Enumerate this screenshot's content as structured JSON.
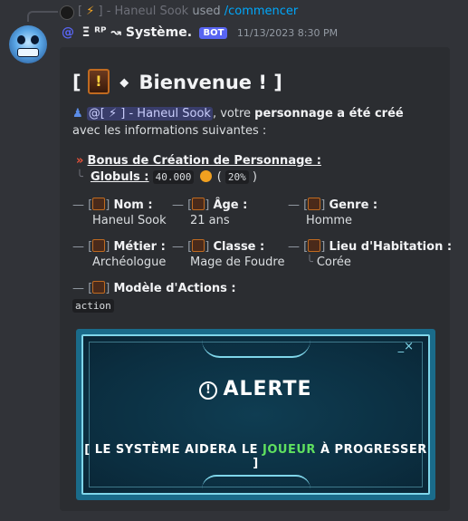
{
  "reply": {
    "prefix": "[",
    "name": "] - Haneul Sook",
    "used": "used",
    "command": "/commencer"
  },
  "header": {
    "username": "Ξ ᴿᴾ ↝ Système.",
    "bot_badge": "BOT",
    "timestamp": "11/13/2023 8:30 PM"
  },
  "embed": {
    "title_open": "[",
    "title_text": "Bienvenue ! ]",
    "mention": "@[ ⚡ ] - Haneul Sook",
    "desc_1": ", votre ",
    "desc_bold": "personnage a été créé",
    "desc_2": " avec les informations suivantes :",
    "bonus_title": "Bonus de Création de Personnage :",
    "globuls_label": "Globuls :",
    "globuls_amount": "40.000",
    "globuls_pct": "20%",
    "fields": [
      {
        "label": "Nom :",
        "value": "Haneul Sook"
      },
      {
        "label": "Âge :",
        "value": "21 ans"
      },
      {
        "label": "Genre :",
        "value": "Homme"
      },
      {
        "label": "Métier :",
        "value": "Archéologue"
      },
      {
        "label": "Classe :",
        "value": "Mage de Foudre"
      },
      {
        "label": "Lieu d'Habitation :",
        "value": "Corée"
      },
      {
        "label": "Modèle d'Actions :",
        "value": "action"
      }
    ]
  },
  "banner": {
    "title": "ALERTE",
    "msg_1": "[ LE SYSTÈME AIDERA LE ",
    "msg_hl": "JOUEUR",
    "msg_2": " À PROGRESSER ]",
    "controls": "_×"
  },
  "colors": {
    "accent": "#5865f2",
    "command": "#00a8fc",
    "banner_highlight": "#5fe05f"
  }
}
